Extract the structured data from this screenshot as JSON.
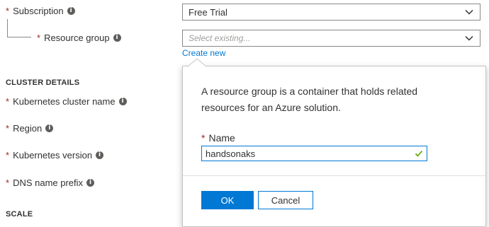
{
  "subscription": {
    "label": "Subscription",
    "value": "Free Trial"
  },
  "resource_group": {
    "label": "Resource group",
    "placeholder": "Select existing...",
    "create_new": "Create new"
  },
  "cluster_details": {
    "title": "CLUSTER DETAILS",
    "fields": [
      {
        "label": "Kubernetes cluster name"
      },
      {
        "label": "Region"
      },
      {
        "label": "Kubernetes version"
      },
      {
        "label": "DNS name prefix"
      }
    ]
  },
  "scale": {
    "title": "SCALE"
  },
  "popup": {
    "description": "A resource group is a container that holds related resources for an Azure solution.",
    "name_label": "Name",
    "name_value": "handsonaks",
    "ok_label": "OK",
    "cancel_label": "Cancel"
  },
  "required_mark": "*",
  "info_glyph": "i",
  "colors": {
    "accent": "#0078d4",
    "required": "#a4262c",
    "valid": "#57a300"
  }
}
